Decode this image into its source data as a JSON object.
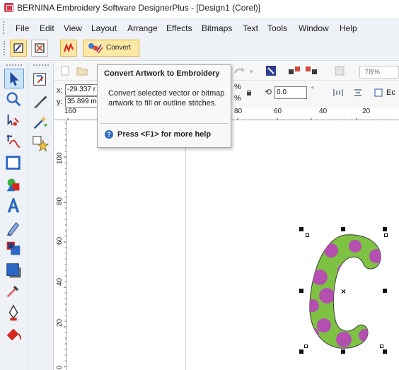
{
  "window": {
    "title": "BERNINA Embroidery Software DesignerPlus - [Design1 (Corel)]"
  },
  "menu": {
    "items": [
      "File",
      "Edit",
      "View",
      "Layout",
      "Arrange",
      "Effects",
      "Bitmaps",
      "Text",
      "Tools",
      "Window",
      "Help"
    ]
  },
  "toolbar": {
    "convert_label": "Convert"
  },
  "props": {
    "x_label": "x:",
    "x_value": "-29.337 r",
    "y_label": "y:",
    "y_value": "35.899 m",
    "rotation_value": "0.0",
    "rotation_unit": "°",
    "percent_symbol": "%",
    "zoom": "78%",
    "partial_label": "Ec"
  },
  "ruler": {
    "h_ticks": [
      "160",
      "80",
      "60",
      "40",
      "20"
    ],
    "v_ticks": [
      "100",
      "80",
      "60",
      "40",
      "20",
      "0"
    ]
  },
  "tooltip": {
    "title": "Convert Artwork to Embroidery",
    "body": "Convert selected vector or bitmap artwork to fill or outline stitches.",
    "help": "Press <F1> for more help",
    "help_icon": "?"
  },
  "artwork": {
    "letter": "C",
    "fill_color": "#7dc242",
    "dot_color": "#b44fb0",
    "outline_color": "#3a3a3a"
  }
}
